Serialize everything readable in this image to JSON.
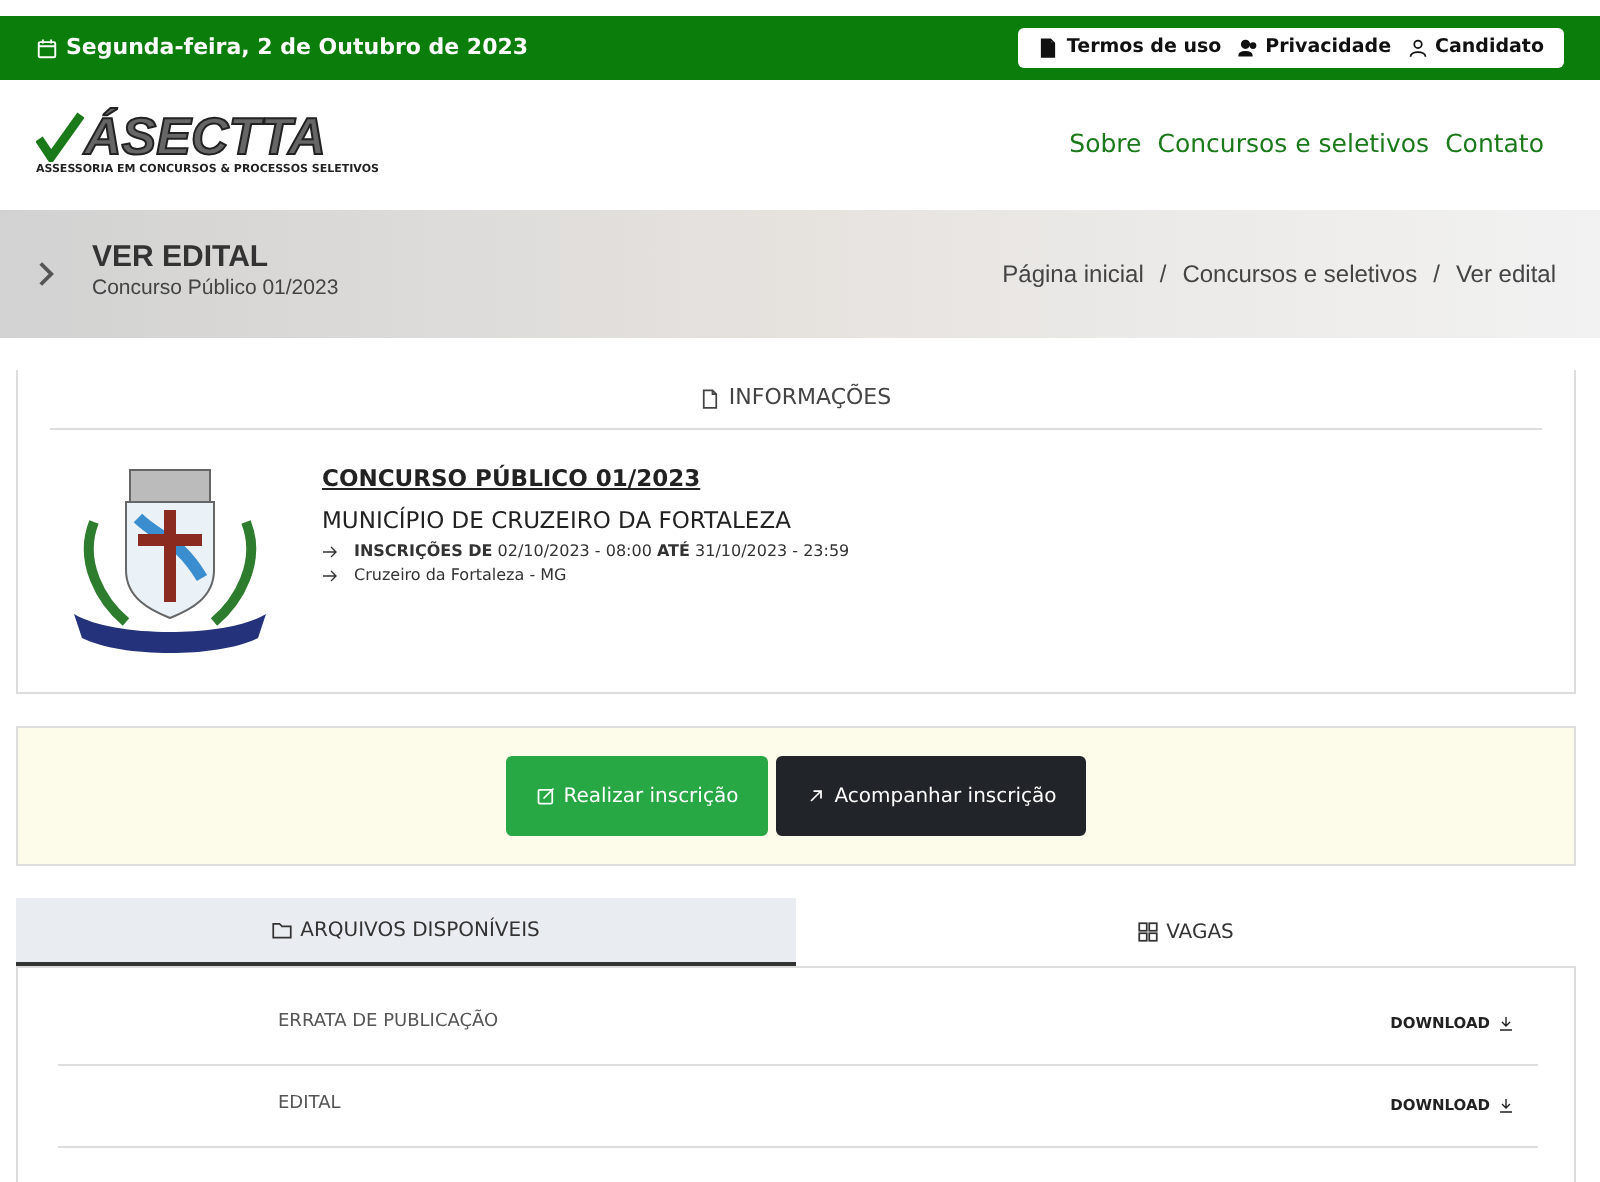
{
  "topbar": {
    "date": "Segunda-feira, 2 de Outubro de 2023",
    "links": [
      {
        "label": "Termos de uso"
      },
      {
        "label": "Privacidade"
      },
      {
        "label": "Candidato"
      }
    ]
  },
  "header": {
    "logo": {
      "name": "ÁSECTTA",
      "tagline": "ASSESSORIA EM CONCURSOS & PROCESSOS SELETIVOS"
    },
    "nav": [
      "Sobre",
      "Concursos e seletivos",
      "Contato"
    ]
  },
  "page_title": {
    "title": "VER EDITAL",
    "subtitle": "Concurso Público 01/2023",
    "breadcrumb": [
      {
        "label": "Página inicial"
      },
      {
        "separator": "/",
        "label": "Concursos e seletivos"
      },
      {
        "separator": "/",
        "label": "Ver edital"
      }
    ]
  },
  "info": {
    "heading": "INFORMAÇÕES",
    "title": "CONCURSO PÚBLICO 01/2023",
    "org": "MUNICÍPIO DE CRUZEIRO DA FORTALEZA",
    "details": [
      "**INSCRIÇÕES DE** 02/10/2023 - 08:00 **ATÉ** 31/10/2023 - 23:59",
      "Cruzeiro da Fortaleza - MG"
    ]
  },
  "actions": [
    {
      "label": "Realizar inscrição",
      "kind": "primary"
    },
    {
      "label": "Acompanhar inscrição",
      "kind": "dark"
    }
  ],
  "tabs": [
    {
      "label": "ARQUIVOS DISPONÍVEIS",
      "selected": true
    },
    {
      "label": "VAGAS",
      "selected": false
    }
  ],
  "files": [
    {
      "name": "ERRATA DE PUBLICAÇÃO",
      "action": "DOWNLOAD"
    },
    {
      "name": "EDITAL",
      "action": "DOWNLOAD"
    }
  ]
}
